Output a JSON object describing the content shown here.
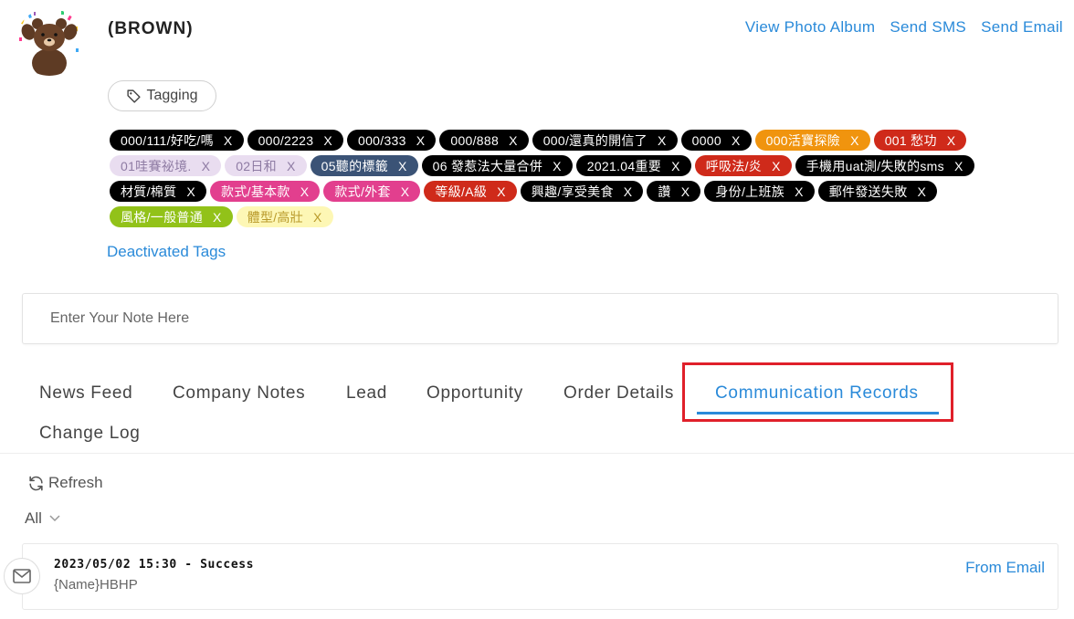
{
  "contact": {
    "name": "(BROWN)"
  },
  "top_links": {
    "photo_album": "View Photo Album",
    "sms": "Send SMS",
    "email": "Send Email"
  },
  "tagging": {
    "label": "Tagging",
    "icon": "tag-icon"
  },
  "tags": [
    {
      "label": "000/111/好吃/嗎",
      "bg": "#000000",
      "fg": "#ffffff"
    },
    {
      "label": "000/2223",
      "bg": "#000000",
      "fg": "#ffffff"
    },
    {
      "label": "000/333",
      "bg": "#000000",
      "fg": "#ffffff"
    },
    {
      "label": "000/888",
      "bg": "#000000",
      "fg": "#ffffff"
    },
    {
      "label": "000/還真的開信了",
      "bg": "#000000",
      "fg": "#ffffff"
    },
    {
      "label": "0000",
      "bg": "#000000",
      "fg": "#ffffff"
    },
    {
      "label": "000活寶探險",
      "bg": "#f0940e",
      "fg": "#ffffff"
    },
    {
      "label": "001 愁功",
      "bg": "#cf2a1a",
      "fg": "#ffffff"
    },
    {
      "label": "01哇賽祕境.",
      "bg": "#e9ddf0",
      "fg": "#8e7ba3"
    },
    {
      "label": "02日和",
      "bg": "#e9ddf0",
      "fg": "#8e7ba3"
    },
    {
      "label": "05聽的標籤",
      "bg": "#3b5376",
      "fg": "#ffffff"
    },
    {
      "label": "06 發惹法大量合併",
      "bg": "#000000",
      "fg": "#ffffff"
    },
    {
      "label": "2021.04重要",
      "bg": "#000000",
      "fg": "#ffffff"
    },
    {
      "label": "呼吸法/炎",
      "bg": "#cf2a1a",
      "fg": "#ffffff"
    },
    {
      "label": "手機用uat測/失敗的sms",
      "bg": "#000000",
      "fg": "#ffffff"
    },
    {
      "label": "材質/棉質",
      "bg": "#000000",
      "fg": "#ffffff"
    },
    {
      "label": "款式/基本款",
      "bg": "#e23f8e",
      "fg": "#ffffff"
    },
    {
      "label": "款式/外套",
      "bg": "#e23f8e",
      "fg": "#ffffff"
    },
    {
      "label": "等級/A級",
      "bg": "#cf2a1a",
      "fg": "#ffffff"
    },
    {
      "label": "興趣/享受美食",
      "bg": "#000000",
      "fg": "#ffffff"
    },
    {
      "label": "讚",
      "bg": "#000000",
      "fg": "#ffffff"
    },
    {
      "label": "身份/上班族",
      "bg": "#000000",
      "fg": "#ffffff"
    },
    {
      "label": "郵件發送失敗",
      "bg": "#000000",
      "fg": "#ffffff"
    },
    {
      "label": "風格/一般普通",
      "bg": "#92c219",
      "fg": "#ffffff"
    },
    {
      "label": "體型/高壯",
      "bg": "#fdf7b5",
      "fg": "#b99a2a"
    }
  ],
  "tag_remove_label": "X",
  "deactivated_tags": "Deactivated Tags",
  "note": {
    "placeholder": "Enter Your Note Here"
  },
  "tabs": {
    "news_feed": "News Feed",
    "company_notes": "Company Notes",
    "lead": "Lead",
    "opportunity": "Opportunity",
    "order_details": "Order Details",
    "communication_records": "Communication Records",
    "change_log": "Change Log",
    "active": "communication_records"
  },
  "toolbar": {
    "refresh": "Refresh",
    "filter": "All"
  },
  "records": [
    {
      "meta": "2023/05/02 15:30 - Success",
      "body": "{Name}HBHP",
      "source": "From Email",
      "icon": "mail-icon"
    }
  ],
  "colors": {
    "accent": "#2a8ad9",
    "highlight": "#e0202a"
  }
}
